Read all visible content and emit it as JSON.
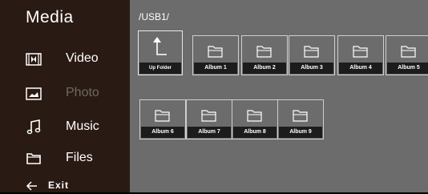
{
  "sidebar": {
    "title": "Media",
    "items": [
      {
        "label": "Video",
        "icon": "film-icon"
      },
      {
        "label": "Photo",
        "icon": "photo-icon"
      },
      {
        "label": "Music",
        "icon": "music-note-icon"
      },
      {
        "label": "Files",
        "icon": "folder-icon"
      }
    ],
    "exit_label": "Exit"
  },
  "main": {
    "path": "/USB1/",
    "up_folder_label": "Up Folder",
    "folders": [
      "Album 1",
      "Album 2",
      "Album 3",
      "Album 4",
      "Album 5",
      "Album 6",
      "Album 7",
      "Album 8",
      "Album 9"
    ]
  },
  "colors": {
    "sidebar_bg": "#2a1a14",
    "main_bg": "#6c6c6c",
    "caption_bg": "#1c1c1c",
    "dim_text": "#6e6863"
  }
}
